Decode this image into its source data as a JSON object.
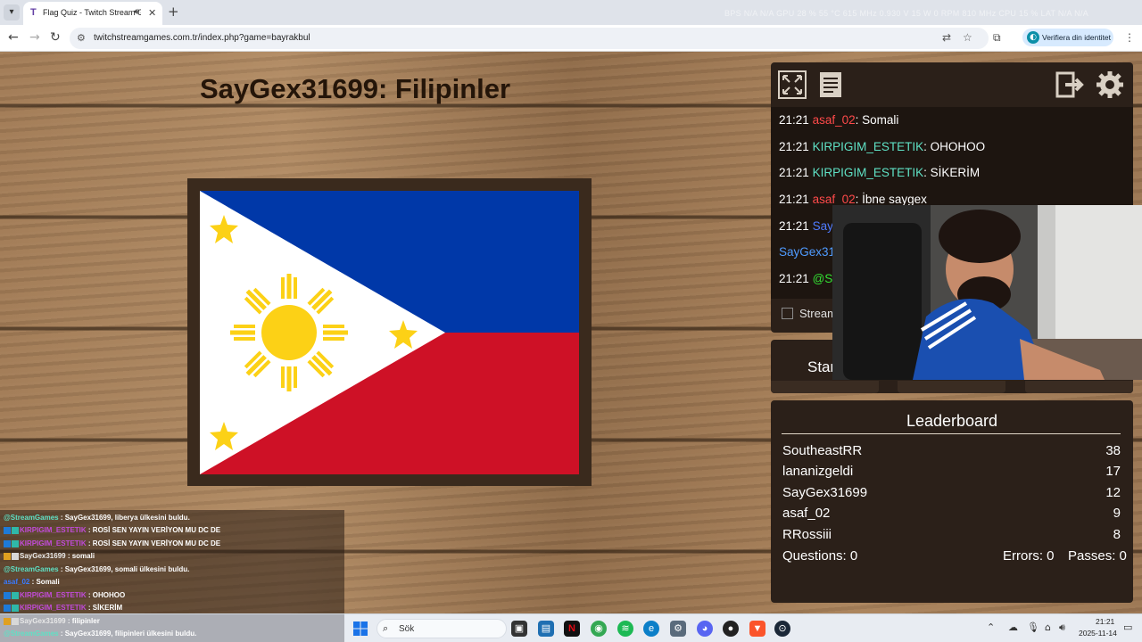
{
  "browser": {
    "tab_title": "Flag Quiz - Twitch Stream G",
    "tab_favicon": "T",
    "url": "twitchstreamgames.com.tr/index.php?game=bayrakbul",
    "verify_label": "Verifiera din identitet",
    "hud_text": "BPS  N/A  N/A    GPU  28 %  55 °C  615 MHz  0.930 V  15 W  0 RPM  810 MHz    CPU  15 %      LAT  N/A  N/A"
  },
  "game": {
    "title": "SayGex31699: Filipinler"
  },
  "chat": {
    "messages": [
      {
        "time": "21:21",
        "user": "asaf_02",
        "color": "#ff4a4a",
        "text": ": Somali"
      },
      {
        "time": "21:21",
        "user": "KIRPIGIM_ESTETIK",
        "color": "#5fe1c5",
        "text": ": OHOHOO"
      },
      {
        "time": "21:21",
        "user": "KIRPIGIM_ESTETIK",
        "color": "#5fe1c5",
        "text": ": SİKERİM"
      },
      {
        "time": "21:21",
        "user": "asaf_02",
        "color": "#ff4a4a",
        "text": ": İbne saygex"
      },
      {
        "time": "21:21",
        "user": "Say",
        "color": "#4f7bff",
        "text": ""
      },
      {
        "time": "",
        "user": "SayGex31",
        "color": "#4f9bff",
        "text": ""
      },
      {
        "time": "21:21",
        "user": "@St",
        "color": "#33e033",
        "text": ""
      }
    ],
    "stream_checkbox_label": "Stream"
  },
  "controls": {
    "start_label": "Star"
  },
  "leaderboard": {
    "title": "Leaderboard",
    "rows": [
      {
        "name": "SoutheastRR",
        "score": "38"
      },
      {
        "name": "lananizgeldi",
        "score": "17"
      },
      {
        "name": "SayGex31699",
        "score": "12"
      },
      {
        "name": "asaf_02",
        "score": "9"
      },
      {
        "name": "RRossiii",
        "score": "8"
      }
    ],
    "questions_label": "Questions: 0",
    "errors_label": "Errors: 0",
    "passes_label": "Passes: 0"
  },
  "overlay_chat": {
    "lines": [
      {
        "user": "@StreamGames",
        "color": "#5fe1c5",
        "text": " : SayGex31699, liberya ülkesini buldu."
      },
      {
        "user": "KIRPIGIM_ESTETIK",
        "color": "#c04ad8",
        "text": " : ROSİ SEN YAYIN VERİYON MU DC DE"
      },
      {
        "user": "KIRPIGIM_ESTETIK",
        "color": "#c04ad8",
        "text": " : ROSİ SEN YAYIN VERİYON MU DC DE"
      },
      {
        "user": "SayGex31699",
        "color": "#e8e8e8",
        "text": " : somali"
      },
      {
        "user": "@StreamGames",
        "color": "#5fe1c5",
        "text": " : SayGex31699, somali ülkesini buldu."
      },
      {
        "user": "asaf_02",
        "color": "#3a7bff",
        "text": " : Somali"
      },
      {
        "user": "KIRPIGIM_ESTETIK",
        "color": "#c04ad8",
        "text": " : OHOHOO"
      },
      {
        "user": "KIRPIGIM_ESTETIK",
        "color": "#c04ad8",
        "text": " : SİKERİM"
      },
      {
        "user": "SayGex31699",
        "color": "#e8e8e8",
        "text": " : filipinler"
      },
      {
        "user": "@StreamGames",
        "color": "#5fe1c5",
        "text": " : SayGex31699, filipinleri ülkesini buldu."
      }
    ]
  },
  "taskbar": {
    "search_placeholder": "Sök",
    "time": "21:21",
    "date": "2025-11-14"
  },
  "icons": {
    "back": "back-arrow-icon",
    "forward": "forward-arrow-icon",
    "reload": "reload-icon",
    "fullscreen": "fullscreen-icon",
    "notes": "document-icon",
    "logout": "logout-icon",
    "settings": "gear-icon"
  }
}
